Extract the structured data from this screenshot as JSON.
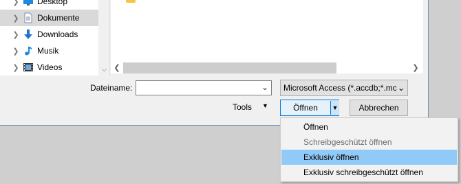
{
  "navigation": {
    "items": [
      {
        "label": "Desktop",
        "icon": "desktop-icon",
        "selected": false
      },
      {
        "label": "Dokumente",
        "icon": "documents-icon",
        "selected": true
      },
      {
        "label": "Downloads",
        "icon": "downloads-icon",
        "selected": false
      },
      {
        "label": "Musik",
        "icon": "music-icon",
        "selected": false
      },
      {
        "label": "Videos",
        "icon": "videos-icon",
        "selected": false
      }
    ]
  },
  "form": {
    "filename_label": "Dateiname:",
    "filename_value": "",
    "filetype_value": "Microsoft Access (*.accdb;*.mc"
  },
  "buttons": {
    "tools_label": "Tools",
    "open_label": "Öffnen",
    "cancel_label": "Abbrechen"
  },
  "open_menu": {
    "items": [
      {
        "label": "Öffnen",
        "disabled": false,
        "highlighted": false
      },
      {
        "label": "Schreibgeschützt öffnen",
        "disabled": true,
        "highlighted": false
      },
      {
        "label": "Exklusiv öffnen",
        "disabled": false,
        "highlighted": true
      },
      {
        "label": "Exklusiv schreibgeschützt öffnen",
        "disabled": false,
        "highlighted": false
      }
    ]
  },
  "colors": {
    "accent": "#0078d7",
    "menu_highlight": "#91c9f7",
    "selected_nav": "#d9d9d9"
  }
}
